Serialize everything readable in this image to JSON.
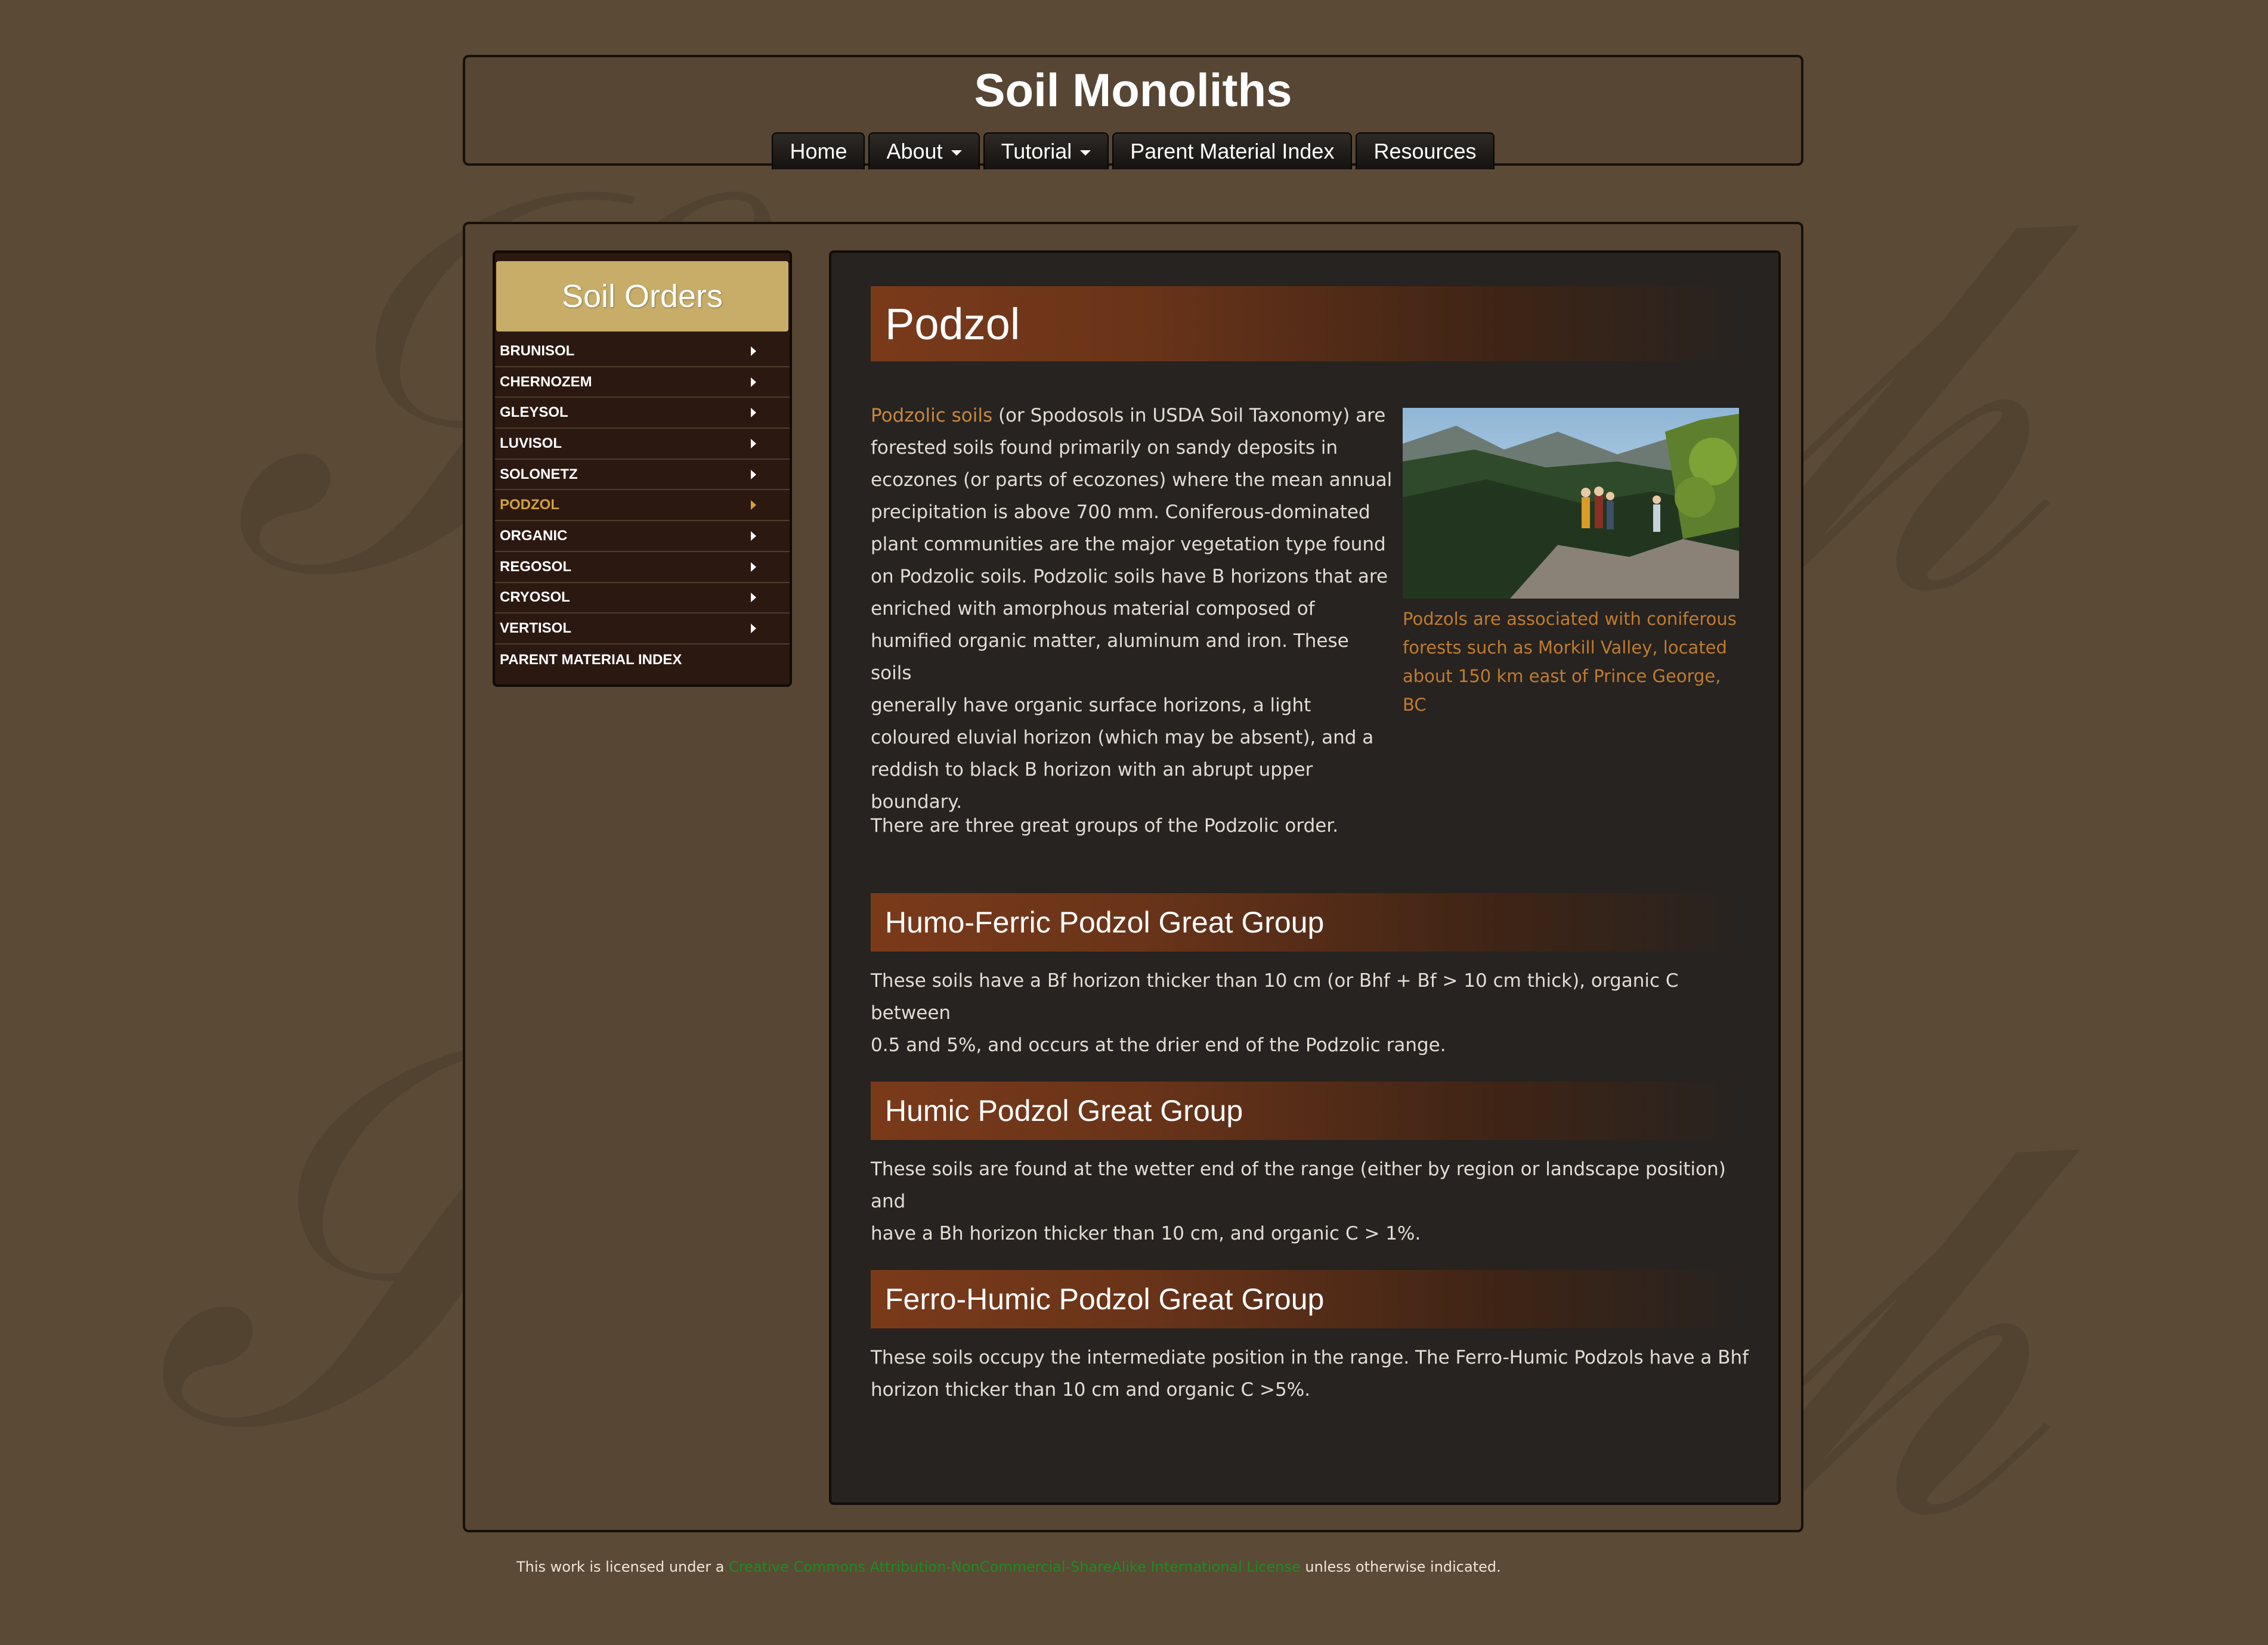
{
  "site": {
    "title": "Soil Monoliths"
  },
  "nav": {
    "items": [
      {
        "label": "Home",
        "dropdown": false
      },
      {
        "label": "About",
        "dropdown": true
      },
      {
        "label": "Tutorial",
        "dropdown": true
      },
      {
        "label": "Parent Material Index",
        "dropdown": false
      },
      {
        "label": "Resources",
        "dropdown": false
      }
    ]
  },
  "sidebar": {
    "title": "Soil Orders",
    "items": [
      {
        "label": "BRUNISOL",
        "arrow": true
      },
      {
        "label": "CHERNOZEM",
        "arrow": true
      },
      {
        "label": "GLEYSOL",
        "arrow": true
      },
      {
        "label": "LUVISOL",
        "arrow": true
      },
      {
        "label": "SOLONETZ",
        "arrow": true
      },
      {
        "label": "PODZOL",
        "arrow": true,
        "active": true
      },
      {
        "label": "ORGANIC",
        "arrow": true
      },
      {
        "label": "REGOSOL",
        "arrow": true
      },
      {
        "label": "CRYOSOL",
        "arrow": true
      },
      {
        "label": "VERTISOL",
        "arrow": true
      },
      {
        "label": "PARENT MATERIAL INDEX",
        "arrow": false
      }
    ]
  },
  "content": {
    "title": "Podzol",
    "intro_link": "Podzolic soils",
    "intro_lines": [
      " (or Spodosols in USDA Soil Taxonomy) are",
      "forested soils found primarily on sandy deposits in",
      "ecozones (or parts of ecozones) where the mean annual",
      "precipitation is above 700 mm. Coniferous-dominated",
      "plant communities are the major vegetation type found",
      "on Podzolic soils. Podzolic soils have B horizons that are",
      "enriched with amorphous material composed of",
      "humified organic matter, aluminum and iron. These soils",
      "generally have organic surface horizons, a light",
      "coloured eluvial horizon (which may be absent), and a",
      "reddish to black B horizon with an abrupt upper",
      "boundary."
    ],
    "groups_sentence": "There are three great groups of the Podzolic order.",
    "image_caption_lines": [
      "Podzols are associated with coniferous",
      "forests such as Morkill Valley, located",
      "about 150 km east of Prince George, BC"
    ],
    "sections": [
      {
        "heading": "Humo-Ferric Podzol Great Group",
        "lines": [
          "These soils have a Bf horizon thicker than 10 cm (or Bhf + Bf > 10 cm thick), organic C  between",
          "0.5 and 5%, and occurs at the drier end of the Podzolic range."
        ]
      },
      {
        "heading": "Humic Podzol Great Group",
        "lines": [
          "These soils are found at the wetter end of the range (either by region or landscape position) and",
          "have a Bh horizon thicker than 10 cm, and organic C > 1%."
        ]
      },
      {
        "heading": "Ferro-Humic Podzol Great Group",
        "lines": [
          "These soils occupy the intermediate position in the range. The Ferro-Humic Podzols have a Bhf",
          "horizon thicker than 10 cm and organic C >5%."
        ]
      }
    ]
  },
  "footer": {
    "prefix": "This work is licensed under a ",
    "license_link": "Creative Commons Attribution-NonCommercial-ShareAlike International License",
    "suffix": " unless otherwise indicated."
  },
  "colors": {
    "page_bg": "#5b4a36",
    "panel_bg": "#262320",
    "sidebar_header": "#c7ad68",
    "accent_orange": "#c9883f",
    "heading_bar": "#7a3a1a",
    "license_link": "#1f8a24"
  }
}
